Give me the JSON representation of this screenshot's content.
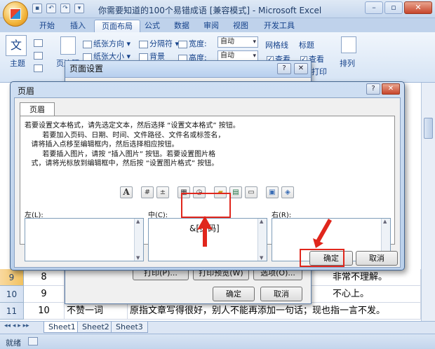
{
  "window": {
    "title": "你需要知道的100个易错成语  [兼容模式] - Microsoft Excel",
    "minimize": "–",
    "restore": "▫",
    "close": "✕"
  },
  "ribbon": {
    "tabs": [
      "开始",
      "插入",
      "页面布局",
      "公式",
      "数据",
      "审阅",
      "视图",
      "开发工具"
    ],
    "active_tab": "页面布局",
    "theme_group_label": "主题",
    "page_margin_label": "页边距",
    "orientation": "纸张方向",
    "size": "纸张大小",
    "breaks": "分隔符",
    "background": "背景",
    "width_label": "宽度:",
    "width_value": "自动",
    "height_label": "高度:",
    "height_value": "自动",
    "gridlines_label": "网格线",
    "headings_label": "标题",
    "view_label": "查看",
    "print_label": "打印",
    "arrange_label": "排列"
  },
  "rows": [
    {
      "num": "9",
      "col_b": "8",
      "col_c": "",
      "col_d": "非常不理解。",
      "selected": true
    },
    {
      "num": "10",
      "col_b": "9",
      "col_c": "",
      "col_d": "不心上。",
      "selected": false
    },
    {
      "num": "11",
      "col_b": "10",
      "col_c": "不赞一词",
      "col_d": "原指文章写得很好，别人不能再添加一句话；现也指一言不发。",
      "selected": false
    }
  ],
  "sheet_tabs": [
    "Sheet1",
    "Sheet2",
    "Sheet3"
  ],
  "status": {
    "ready": "就绪"
  },
  "page_setup": {
    "title": "页面设置",
    "help": "?",
    "close": "✕",
    "print_button": "打印(P)...",
    "preview_button": "打印预览(W)",
    "options_button": "选项(O)...",
    "ok": "确定",
    "cancel": "取消"
  },
  "header_dialog": {
    "title": "页眉",
    "help": "?",
    "close": "✕",
    "tab": "页眉",
    "instructions": "若要设置文本格式，请先选定文本，然后选择 “设置文本格式” 按钮。\n        若要加入页码、日期、时间、文件路径、文件名或标签名，\n   请将插入点移至编辑框内，然后选择相应按钮。\n        若要插入图片，请按 “插入图片” 按钮。若要设置图片格\n   式，请将光标放到编辑框中，然后按 “设置图片格式” 按钮。",
    "left_label": "左(L):",
    "center_label": "中(C):",
    "right_label": "右(R):",
    "center_content": "&[页码]",
    "ok": "确定",
    "cancel": "取消",
    "toolbar_icons": [
      "format-text-icon",
      "page-number-icon",
      "page-count-icon",
      "date-icon",
      "time-icon",
      "file-path-icon",
      "file-name-icon",
      "sheet-name-icon",
      "insert-picture-icon",
      "format-picture-icon"
    ]
  },
  "colors": {
    "annotation_red": "#e0261c",
    "ribbon_blue": "#15428b"
  }
}
